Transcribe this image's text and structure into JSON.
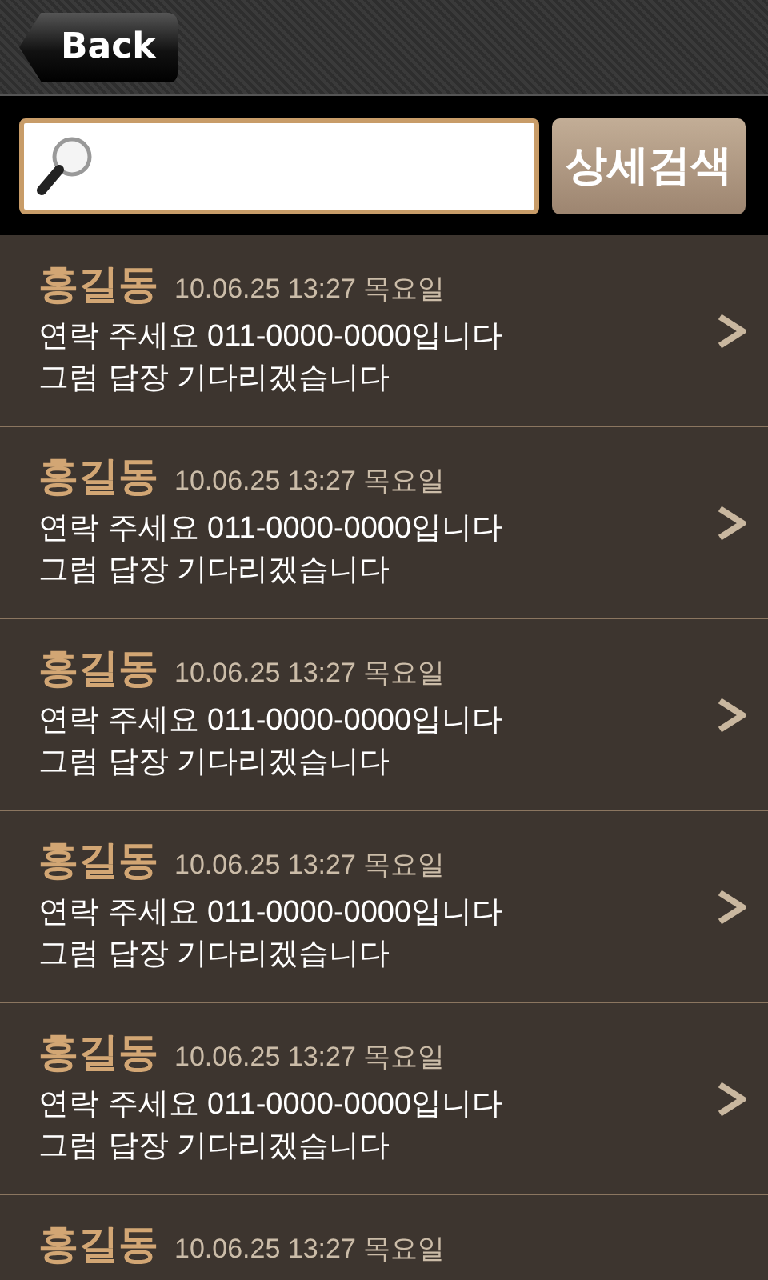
{
  "header": {
    "back_button": "Back"
  },
  "search": {
    "button": "상세검색"
  },
  "messages": [
    {
      "name": "홍길동",
      "date": "10.06.25 13:27 목요일",
      "lines": [
        "연락 주세요 011-0000-0000입니다",
        "그럼 답장 기다리겠습니다"
      ]
    },
    {
      "name": "홍길동",
      "date": "10.06.25 13:27 목요일",
      "lines": [
        "연락 주세요 011-0000-0000입니다",
        "그럼 답장 기다리겠습니다"
      ]
    },
    {
      "name": "홍길동",
      "date": "10.06.25 13:27 목요일",
      "lines": [
        "연락 주세요 011-0000-0000입니다",
        "그럼 답장 기다리겠습니다"
      ]
    },
    {
      "name": "홍길동",
      "date": "10.06.25 13:27 목요일",
      "lines": [
        "연락 주세요 011-0000-0000입니다",
        "그럼 답장 기다리겠습니다"
      ]
    },
    {
      "name": "홍길동",
      "date": "10.06.25 13:27 목요일",
      "lines": [
        "연락 주세요 011-0000-0000입니다",
        "그럼 답장 기다리겠습니다"
      ]
    },
    {
      "name": "홍길동",
      "date": "10.06.25 13:27 목요일"
    }
  ]
}
